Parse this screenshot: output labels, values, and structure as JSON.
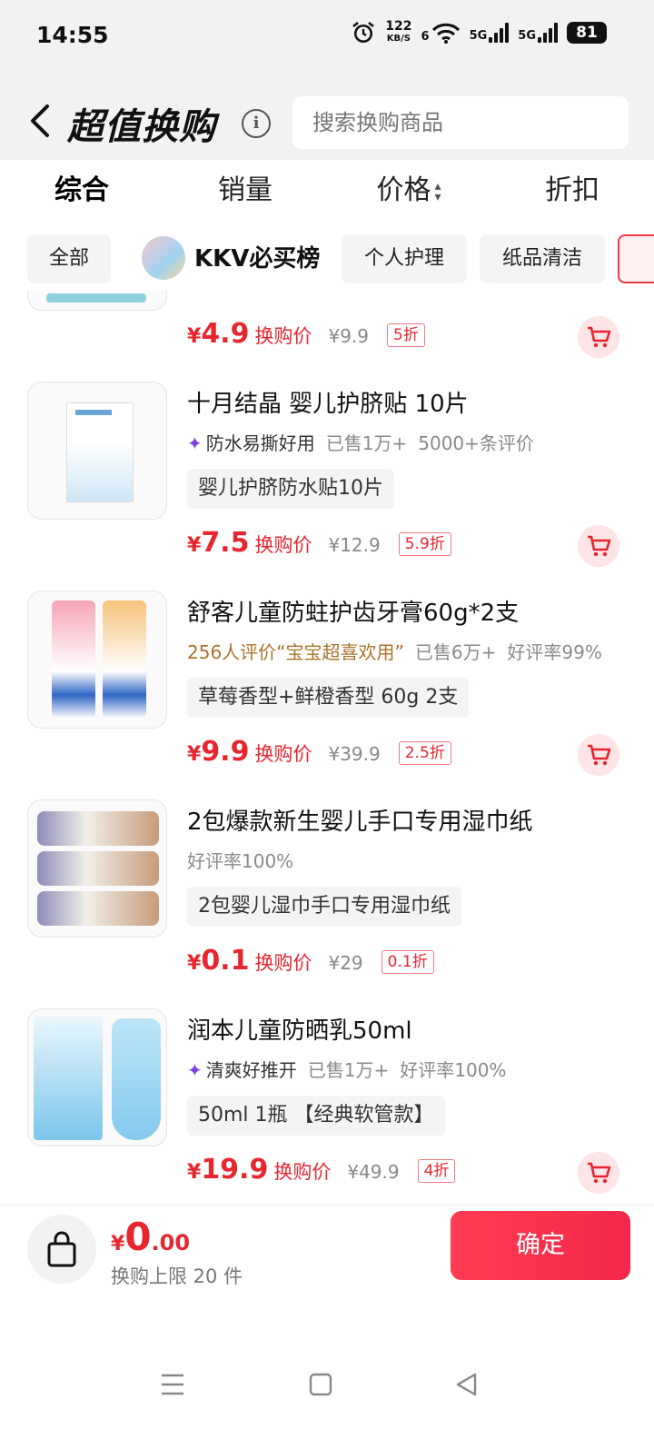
{
  "status_bar": {
    "time": "14:55",
    "net_speed": "122",
    "net_unit": "KB/S",
    "wifi_badge": "6",
    "signal1": "5G",
    "signal2": "5G",
    "battery": "81"
  },
  "header": {
    "back_icon": "chevron-left-icon",
    "title": "超值换购",
    "info_glyph": "i",
    "search_placeholder": "搜索换购商品"
  },
  "sort_tabs": [
    {
      "label": "综合",
      "active": true
    },
    {
      "label": "销量",
      "active": false
    },
    {
      "label": "价格",
      "active": false
    },
    {
      "label": "折扣",
      "active": false
    }
  ],
  "categories": [
    "全部",
    "KKV必买榜",
    "个人护理",
    "纸品清洁"
  ],
  "products": [
    {
      "name": "",
      "price": "4.9",
      "price_label": "换购价",
      "original": "¥9.9",
      "discount": "5折"
    },
    {
      "name": "十月结晶 婴儿护脐贴 10片",
      "tag_prefix": "防水易撕好用",
      "sold": "已售1万+",
      "reviews": "5000+条评价",
      "spec": "婴儿护脐防水贴10片",
      "price": "7.5",
      "price_label": "换购价",
      "original": "¥12.9",
      "discount": "5.9折"
    },
    {
      "name": "舒客儿童防蛀护齿牙膏60g*2支",
      "tag_prefix": "256人评价“宝宝超喜欢用”",
      "sold": "已售6万+",
      "reviews": "好评率99%",
      "spec": "草莓香型+鲜橙香型 60g 2支",
      "price": "9.9",
      "price_label": "换购价",
      "original": "¥39.9",
      "discount": "2.5折"
    },
    {
      "name": "2包爆款新生婴儿手口专用湿巾纸",
      "tag_prefix": "好评率100%",
      "spec": "2包婴儿湿巾手口专用湿巾纸",
      "price": "0.1",
      "price_label": "换购价",
      "original": "¥29",
      "discount": "0.1折"
    },
    {
      "name": "润本儿童防晒乳50ml",
      "tag_prefix": "清爽好推开",
      "sold": "已售1万+",
      "reviews": "好评率100%",
      "spec": "50ml 1瓶 【经典软管款】",
      "price": "19.9",
      "price_label": "换购价",
      "original": "¥49.9",
      "discount": "4折"
    }
  ],
  "bottom_bar": {
    "currency": "¥",
    "total_int": "0",
    "total_dec": ".00",
    "limit_text": "换购上限 20 件",
    "confirm_label": "确定"
  },
  "colors": {
    "accent": "#e8262f",
    "button": "#f4284a",
    "tag_star": "#7b3fe4"
  }
}
